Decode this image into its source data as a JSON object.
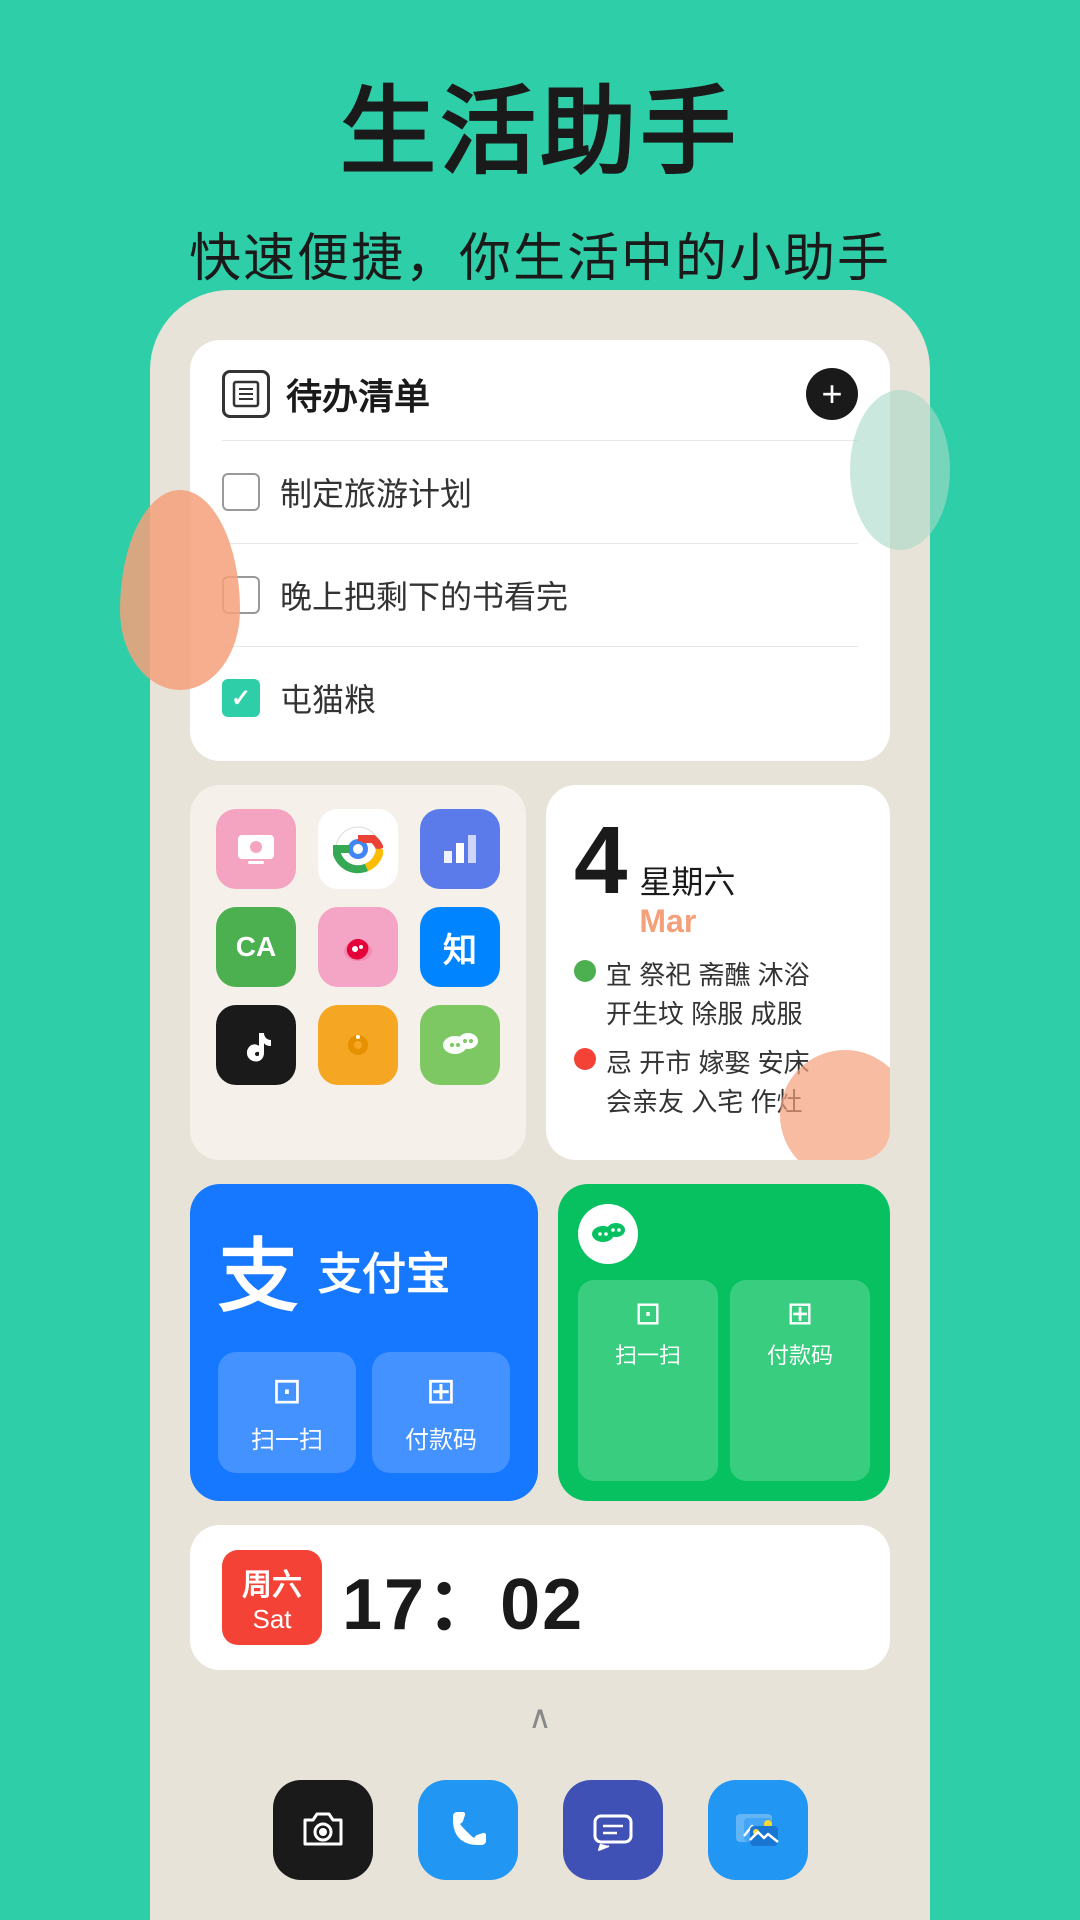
{
  "header": {
    "title": "生活助手",
    "subtitle": "快速便捷，你生活中的小助手"
  },
  "todo_widget": {
    "title": "待办清单",
    "add_label": "+",
    "items": [
      {
        "text": "制定旅游计划",
        "checked": false
      },
      {
        "text": "晚上把剩下的书看完",
        "checked": false
      },
      {
        "text": "屯猫粮",
        "checked": true
      }
    ]
  },
  "apps": [
    {
      "name": "tv-app",
      "bg": "pink",
      "emoji": "📺"
    },
    {
      "name": "chrome",
      "bg": "chrome",
      "emoji": "🌐"
    },
    {
      "name": "bar-chart-app",
      "bg": "bar-chart",
      "emoji": "📊"
    },
    {
      "name": "ca-app",
      "bg": "green",
      "emoji": "CA"
    },
    {
      "name": "weibo",
      "bg": "weibo",
      "emoji": "微"
    },
    {
      "name": "zhihu",
      "bg": "zhihu",
      "emoji": "知"
    },
    {
      "name": "tiktok",
      "bg": "tiktok",
      "emoji": "♪"
    },
    {
      "name": "music",
      "bg": "music",
      "emoji": "♬"
    },
    {
      "name": "wechat-app",
      "bg": "wechat",
      "emoji": "💬"
    }
  ],
  "calendar": {
    "date": "4",
    "weekday": "星期六",
    "month": "Mar",
    "good_label": "宜",
    "good_items": "祭祀  斋醮  沐浴\n开生坟  除服  成服",
    "bad_label": "忌",
    "bad_items": "开市  嫁娶  安床\n会亲友  入宅  作灶"
  },
  "alipay": {
    "logo": "支",
    "name": "支付宝",
    "scan_label": "扫一扫",
    "pay_label": "付款码"
  },
  "wechat_pay": {
    "scan_label": "扫一扫",
    "pay_label": "付款码"
  },
  "clock": {
    "weekday": "周六",
    "day_abbr": "Sat",
    "time": "17：02"
  },
  "dock": {
    "icons": [
      "camera",
      "phone",
      "message",
      "gallery"
    ]
  },
  "colors": {
    "bg": "#2ECFA8",
    "alipay_blue": "#1677ff",
    "wechat_green": "#07C160",
    "bad_red": "#f44336"
  }
}
